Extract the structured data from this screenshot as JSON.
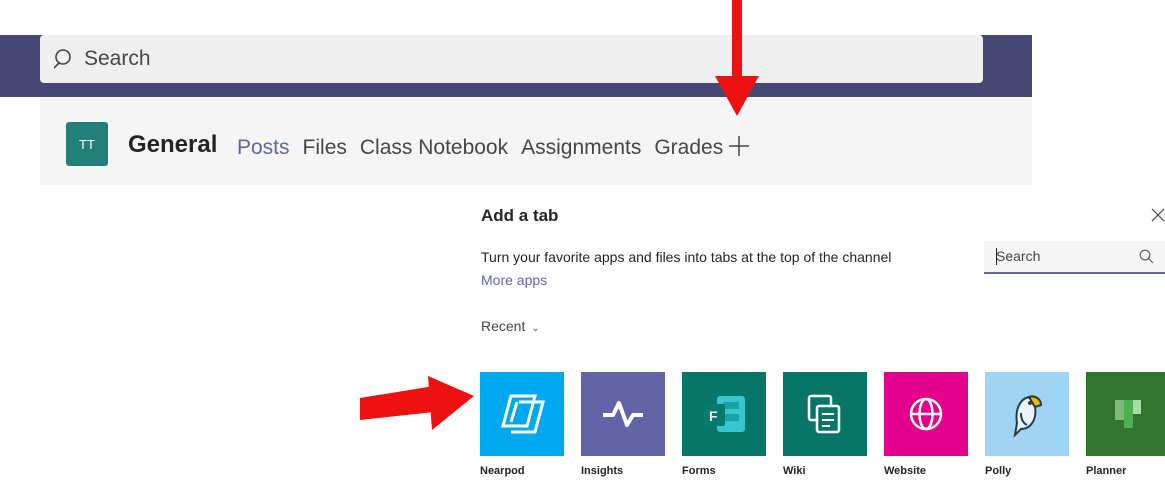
{
  "search": {
    "label": "Search"
  },
  "channel": {
    "avatar_initials": "TT",
    "title": "General",
    "tabs": [
      {
        "label": "Posts",
        "active": true
      },
      {
        "label": "Files",
        "active": false
      },
      {
        "label": "Class Notebook",
        "active": false
      },
      {
        "label": "Assignments",
        "active": false
      },
      {
        "label": "Grades",
        "active": false
      }
    ]
  },
  "dialog": {
    "title": "Add a tab",
    "description": "Turn your favorite apps and files into tabs at the top of the channel",
    "more_apps": "More apps",
    "search_placeholder": "Search",
    "recent_label": "Recent",
    "apps": [
      {
        "name": "Nearpod",
        "color": "#00a8f0",
        "icon": "nearpod-icon"
      },
      {
        "name": "Insights",
        "color": "#6264a7",
        "icon": "insights-icon"
      },
      {
        "name": "Forms",
        "color": "#077568",
        "icon": "forms-icon"
      },
      {
        "name": "Wiki",
        "color": "#077568",
        "icon": "wiki-icon"
      },
      {
        "name": "Website",
        "color": "#e3008c",
        "icon": "globe-icon"
      },
      {
        "name": "Polly",
        "color": "#9fd4f5",
        "icon": "polly-icon"
      },
      {
        "name": "Planner",
        "color": "#31752f",
        "icon": "planner-icon"
      }
    ]
  },
  "colors": {
    "topbar": "#464775",
    "accent": "#6264a7",
    "annotation_arrow": "#ee1111"
  }
}
